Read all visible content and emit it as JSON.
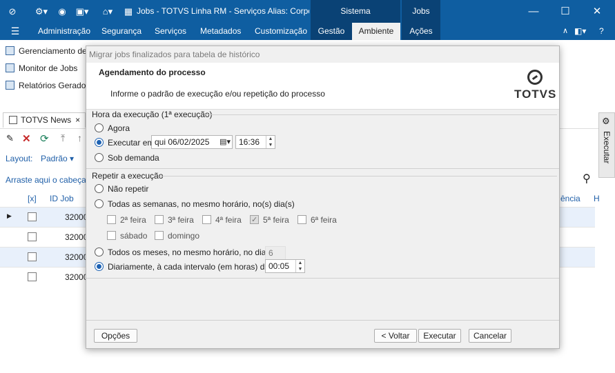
{
  "window": {
    "title": "Jobs - TOTVS Linha RM - Serviços  Alias: CorporeR…",
    "tab_sistema": "Sistema",
    "tab_jobs": "Jobs"
  },
  "menu": {
    "items": [
      "Administração",
      "Segurança",
      "Serviços",
      "Metadados",
      "Customização",
      "Gestão",
      "Ambiente",
      "Ações"
    ],
    "active": "Ambiente"
  },
  "nav": {
    "items": [
      "Gerenciamento de Jobs",
      "Monitor de Jobs",
      "Relatórios Gerados"
    ]
  },
  "tab": {
    "label": "TOTVS News",
    "close": "×"
  },
  "toolbar": {
    "layout_label": "Layout:",
    "layout_value": "Padrão ▾"
  },
  "group_hint": "Arraste aqui o cabeçalho",
  "grid": {
    "col_check": "[x]",
    "col_id": "ID Job",
    "col_freq": "ência",
    "col_h": "H",
    "rows": [
      {
        "id": "32000"
      },
      {
        "id": "32000"
      },
      {
        "id": "32000"
      },
      {
        "id": "32000"
      }
    ]
  },
  "side": {
    "label": "Executar"
  },
  "dialog": {
    "title": "Migrar jobs finalizados para tabela de histórico",
    "heading": "Agendamento do processo",
    "subheading": "Informe o padrão de execução e/ou repetição do processo",
    "logo": "TOTVS",
    "exec_section": "Hora da execução (1ª execução)",
    "opt_now": "Agora",
    "opt_exec_at": "Executar em",
    "date": "qui  06/02/2025",
    "time": "16:36",
    "opt_on_demand": "Sob demanda",
    "repeat_section": "Repetir a execução",
    "opt_no_repeat": "Não repetir",
    "opt_weekly": "Todas as semanas, no mesmo horário, no(s) dia(s)",
    "days": [
      {
        "label": "2ª feira",
        "checked": false
      },
      {
        "label": "3ª feira",
        "checked": false
      },
      {
        "label": "4ª feira",
        "checked": false
      },
      {
        "label": "5ª feira",
        "checked": true
      },
      {
        "label": "6ª feira",
        "checked": false
      },
      {
        "label": "sábado",
        "checked": false
      },
      {
        "label": "domingo",
        "checked": false
      }
    ],
    "opt_monthly": "Todos os meses, no mesmo horário, no dia",
    "month_day": "6",
    "opt_daily": "Diariamente, à cada intervalo (em horas) de",
    "interval": "00:05",
    "btn_options": "Opções",
    "btn_back": "< Voltar",
    "btn_execute": "Executar",
    "btn_cancel": "Cancelar"
  },
  "colors": {
    "brand": "#0f5ea1",
    "brand_dark": "#0a4275",
    "radio_selected": "#1d62b3"
  }
}
